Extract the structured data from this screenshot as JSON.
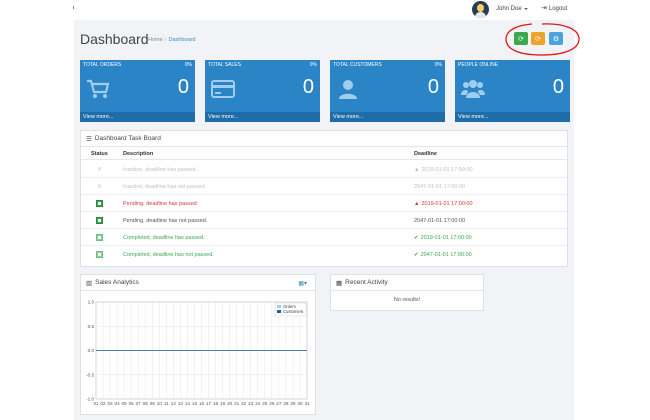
{
  "topbar": {
    "user_name": "John Doe",
    "logout_label": "Logout"
  },
  "header": {
    "title": "Dashboard",
    "breadcrumb": [
      "Home",
      "Dashboard"
    ]
  },
  "tiles": [
    {
      "label": "TOTAL ORDERS",
      "percent": "0%",
      "value": "0",
      "more": "View more...",
      "icon": "cart-icon"
    },
    {
      "label": "TOTAL SALES",
      "percent": "0%",
      "value": "0",
      "more": "View more...",
      "icon": "credit-card-icon"
    },
    {
      "label": "TOTAL CUSTOMERS",
      "percent": "0%",
      "value": "0",
      "more": "View more...",
      "icon": "user-icon"
    },
    {
      "label": "PEOPLE ONLINE",
      "percent": "",
      "value": "0",
      "more": "View more...",
      "icon": "users-icon"
    }
  ],
  "taskboard": {
    "title": "Dashboard Task Board",
    "columns": {
      "status": "Status",
      "description": "Description",
      "deadline": "Deadline"
    },
    "rows": [
      {
        "status": "inactive",
        "description": "Inactive, deadline has passed.",
        "deadline": "2019-01-01 17:00:00",
        "deadline_icon": "warning-icon"
      },
      {
        "status": "inactive",
        "description": "Inactive, deadline has not passed.",
        "deadline": "2047-01-01 17:00:00",
        "deadline_icon": ""
      },
      {
        "status": "pending",
        "description": "Pending, deadline has passed.",
        "deadline": "2019-01-01 17:00:00",
        "deadline_icon": "warning-icon"
      },
      {
        "status": "pending",
        "description": "Pending, deadline has not passed.",
        "deadline": "2047-01-01 17:00:00",
        "deadline_icon": ""
      },
      {
        "status": "completed",
        "description": "Completed, deadline has passed.",
        "deadline": "2019-01-01 17:00:00",
        "deadline_icon": "check-icon"
      },
      {
        "status": "completed",
        "description": "Completed, deadline has not passed.",
        "deadline": "2047-01-01 17:00:00",
        "deadline_icon": "check-icon"
      }
    ]
  },
  "sales": {
    "title": "Sales Analytics"
  },
  "activity": {
    "title": "Recent Activity",
    "empty": "No results!"
  },
  "colors": {
    "tile": "#2b84c6",
    "tile_footer": "#1f6da8",
    "green": "#3aa94d",
    "orange": "#f0a32a",
    "light_blue": "#4aa3df",
    "red": "#d63a2f",
    "annotation": "#e01818"
  },
  "chart_data": {
    "type": "line",
    "title": "",
    "xlabel": "",
    "ylabel": "",
    "categories": [
      "01",
      "02",
      "03",
      "04",
      "05",
      "06",
      "07",
      "08",
      "09",
      "10",
      "11",
      "12",
      "13",
      "14",
      "15",
      "16",
      "17",
      "18",
      "19",
      "20",
      "21",
      "22",
      "23",
      "24",
      "25",
      "26",
      "27",
      "28",
      "29",
      "30",
      "31"
    ],
    "y_ticks": [
      "1.0",
      "0.5",
      "0.0",
      "-0.5",
      "-1.0"
    ],
    "ylim": [
      -1,
      1
    ],
    "grid": true,
    "legend_position": "top-right",
    "series": [
      {
        "name": "Orders",
        "color": "#a8cbe8",
        "values": [
          0,
          0,
          0,
          0,
          0,
          0,
          0,
          0,
          0,
          0,
          0,
          0,
          0,
          0,
          0,
          0,
          0,
          0,
          0,
          0,
          0,
          0,
          0,
          0,
          0,
          0,
          0,
          0,
          0,
          0,
          0
        ]
      },
      {
        "name": "Customers",
        "color": "#1f5fa8",
        "values": [
          0,
          0,
          0,
          0,
          0,
          0,
          0,
          0,
          0,
          0,
          0,
          0,
          0,
          0,
          0,
          0,
          0,
          0,
          0,
          0,
          0,
          0,
          0,
          0,
          0,
          0,
          0,
          0,
          0,
          0,
          0
        ]
      }
    ]
  }
}
